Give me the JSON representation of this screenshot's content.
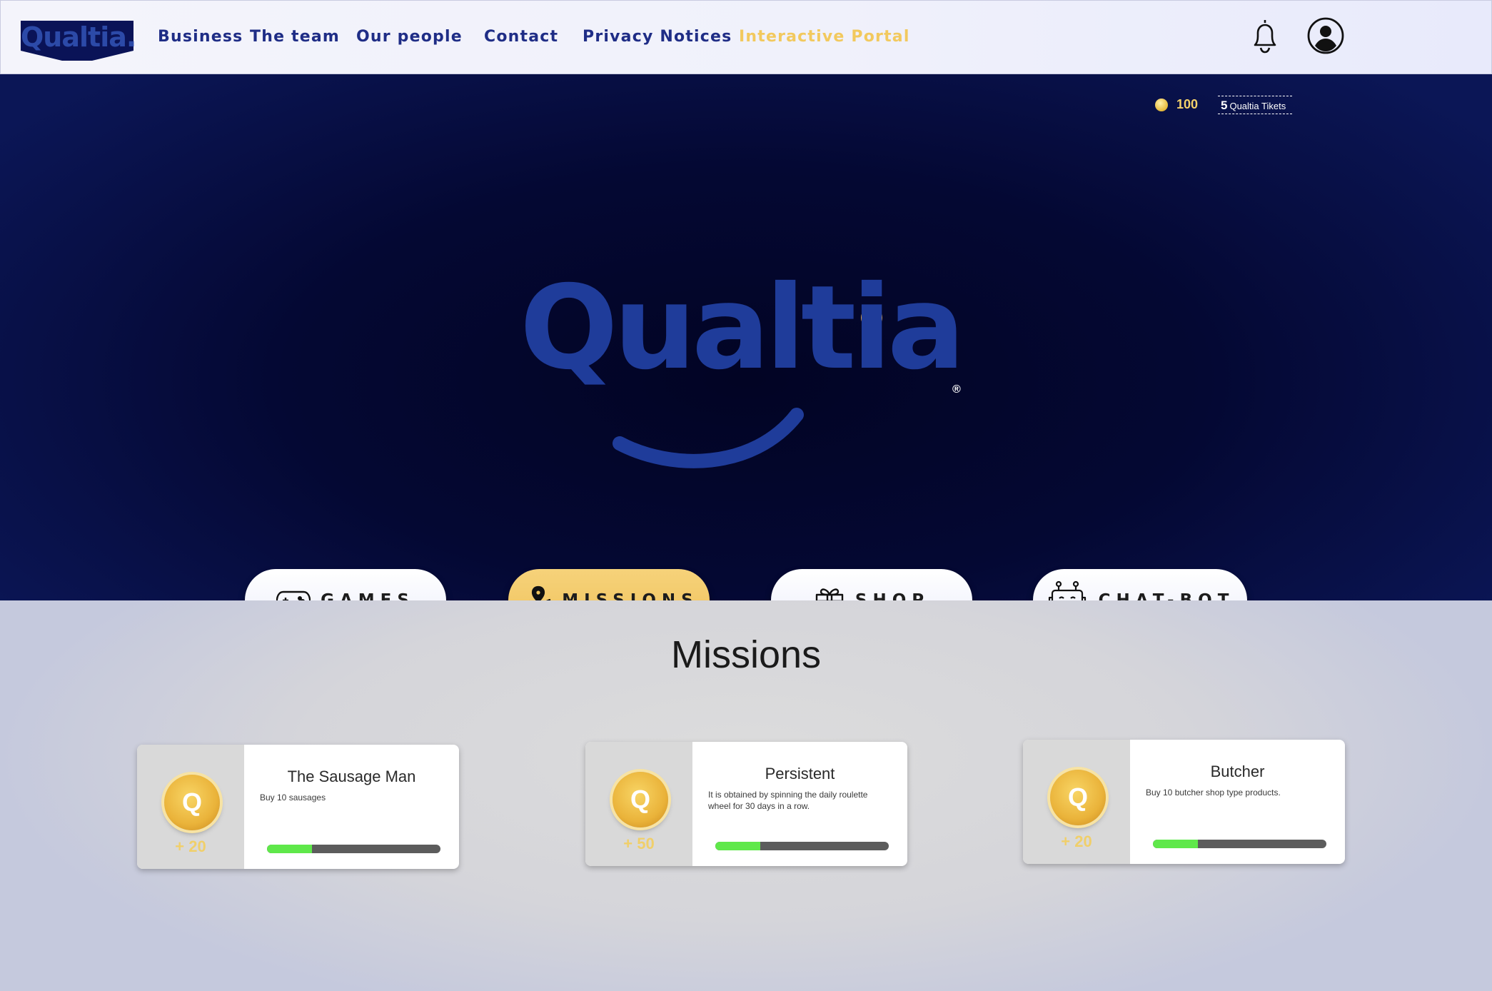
{
  "header": {
    "logo_text": "Qualtia.",
    "nav": [
      {
        "label": "Business",
        "active": false
      },
      {
        "label": "The team",
        "active": false
      },
      {
        "label": "Our people",
        "active": false
      },
      {
        "label": "Contact",
        "active": false
      },
      {
        "label": "Privacy Notices",
        "active": false
      },
      {
        "label": "Interactive Portal",
        "active": true
      }
    ],
    "icons": [
      "bell-icon",
      "user-profile-icon"
    ]
  },
  "wallet": {
    "coins": "100",
    "tickets_count": "5",
    "tickets_label": "Qualtia Tikets"
  },
  "hero": {
    "logo_text": "Qualtia",
    "registered_mark": "®"
  },
  "menu": [
    {
      "label": "GAMES",
      "icon": "gamepad-icon",
      "active": false
    },
    {
      "label": "MISSIONS",
      "icon": "map-pin-icon",
      "active": true
    },
    {
      "label": "SHOP",
      "icon": "gift-icon",
      "active": false
    },
    {
      "label": "CHAT-BOT",
      "icon": "robot-chat-icon",
      "active": false
    }
  ],
  "missions": {
    "title": "Missions",
    "items": [
      {
        "name": "The Sausage Man",
        "desc": "Buy 10 sausages",
        "reward": "+ 20",
        "coin_letter": "Q",
        "progress": 0.26
      },
      {
        "name": "Persistent",
        "desc": "It is obtained by spinning the daily roulette wheel for 30 days in a row.",
        "reward": "+ 50",
        "coin_letter": "Q",
        "progress": 0.26
      },
      {
        "name": "Butcher",
        "desc": "Buy 10 butcher shop type products.",
        "reward": "+ 20",
        "coin_letter": "Q",
        "progress": 0.26
      }
    ]
  },
  "colors": {
    "brand_navy": "#1f2d86",
    "brand_blue": "#1f3c9a",
    "accent_gold": "#f2c95e",
    "progress_green": "#5fe84a"
  }
}
